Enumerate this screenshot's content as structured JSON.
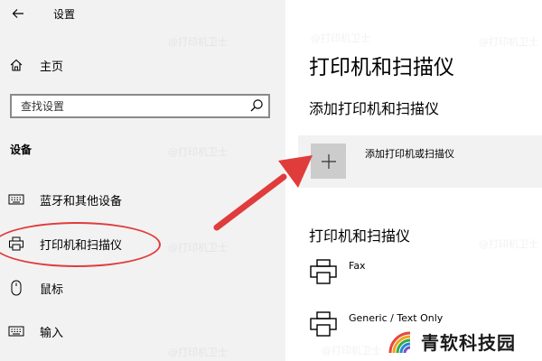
{
  "window": {
    "title": "设置"
  },
  "sidebar": {
    "home_label": "主页",
    "search_placeholder": "查找设置",
    "section_label": "设备",
    "items": [
      {
        "label": "蓝牙和其他设备",
        "icon": "keyboard-icon"
      },
      {
        "label": "打印机和扫描仪",
        "icon": "printer-icon"
      },
      {
        "label": "鼠标",
        "icon": "mouse-icon"
      },
      {
        "label": "输入",
        "icon": "keyboard-icon"
      }
    ]
  },
  "main": {
    "title": "打印机和扫描仪",
    "add_section_title": "添加打印机和扫描仪",
    "add_button_label": "添加打印机或扫描仪",
    "list_section_title": "打印机和扫描仪",
    "devices": [
      {
        "name": "Fax"
      },
      {
        "name": "Generic / Text Only"
      }
    ]
  },
  "watermark": "@打印机卫士",
  "brand": {
    "name": "青软科技园"
  },
  "colors": {
    "sidebar_bg": "#f2f2f2",
    "annotation_red": "#e03c3c",
    "plus_tile": "#cccccc"
  }
}
